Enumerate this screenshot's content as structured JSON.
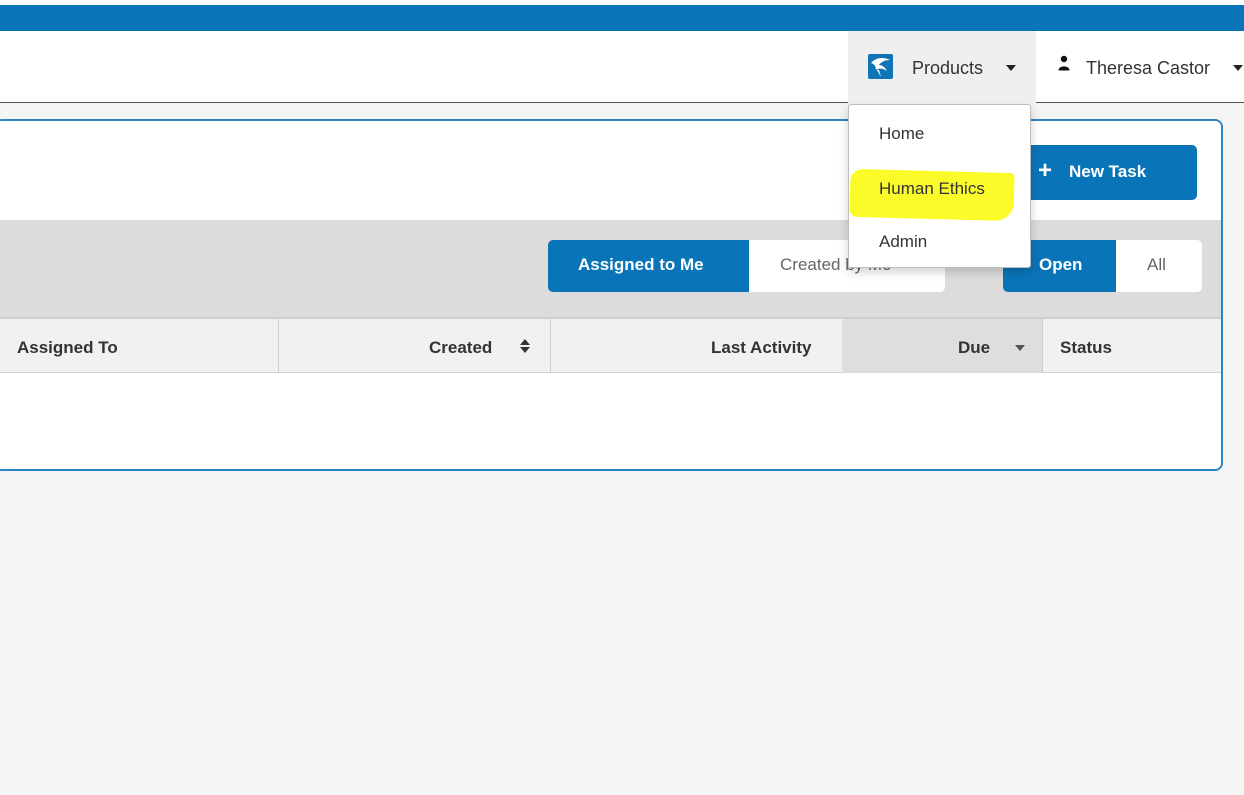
{
  "colors": {
    "brand_blue": "#0a74b8",
    "panel_border": "#2b84c4",
    "highlight_yellow": "#fbfb2a",
    "filter_bar_gray": "#dcdcdc"
  },
  "navbar": {
    "products": {
      "label": "Products",
      "icon": "app-logo-icon"
    },
    "user": {
      "name": "Theresa Castor",
      "icon": "user-icon"
    }
  },
  "products_menu": {
    "items": [
      {
        "label": "Home"
      },
      {
        "label": "Human Ethics",
        "highlighted": true
      },
      {
        "label": "Admin"
      }
    ]
  },
  "toolbar": {
    "new_task_label": "New Task"
  },
  "filters": {
    "scope": [
      {
        "label": "Assigned to Me",
        "active": true
      },
      {
        "label": "Created by Me",
        "active": false
      }
    ],
    "state": [
      {
        "label": "Open",
        "active": true
      },
      {
        "label": "All",
        "active": false
      }
    ]
  },
  "table": {
    "columns": [
      {
        "label": "Assigned To"
      },
      {
        "label": "Created"
      },
      {
        "label": "Last Activity"
      },
      {
        "label": "Due"
      },
      {
        "label": "Status"
      }
    ]
  }
}
